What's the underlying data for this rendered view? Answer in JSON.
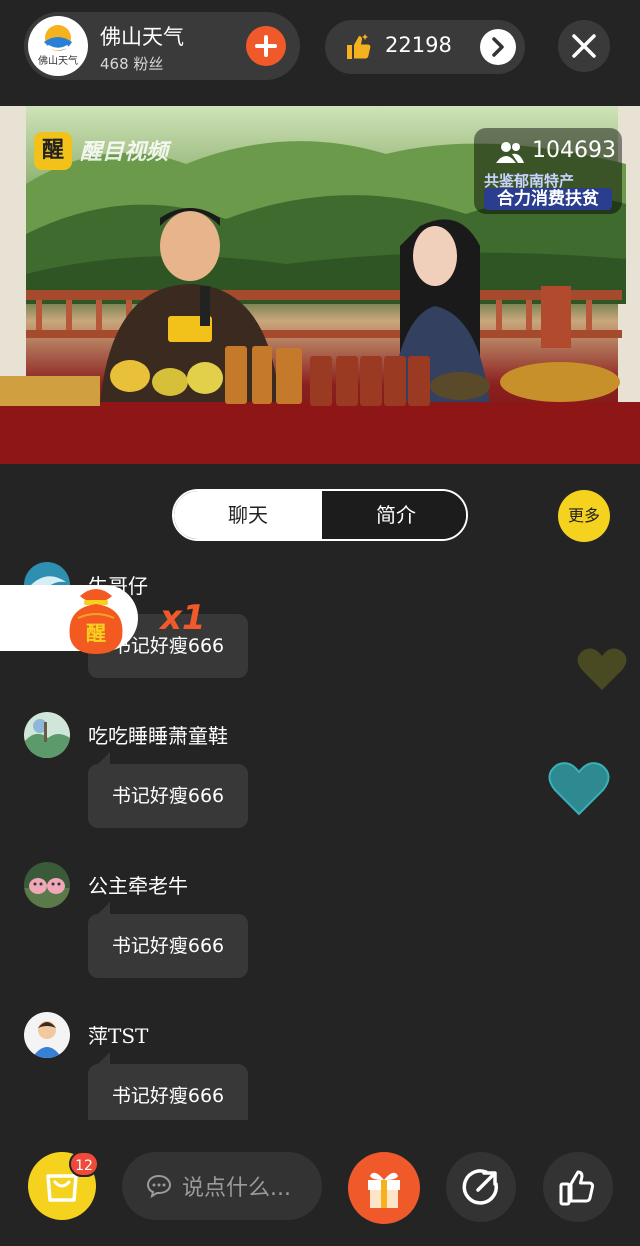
{
  "host": {
    "name": "佛山天气",
    "fans": "468 粉丝",
    "avatar_text": "佛山天气",
    "follow_icon": "plus-icon"
  },
  "likes": {
    "count": "22198",
    "icon": "thumbs-up-icon",
    "next_icon": "chevron-right-icon"
  },
  "close_icon": "close-icon",
  "video": {
    "watermark_badge": "醒",
    "watermark_text": "醒目视频",
    "viewers": "104693",
    "tag_line1": "共鉴郁南特产",
    "tag_line2": "合力消费扶贫",
    "mic_label": "醒目视频"
  },
  "tabs": {
    "chat": "聊天",
    "intro": "简介",
    "active": "chat"
  },
  "more": "更多",
  "gift_overlay": {
    "bag_text": "醒",
    "count": "x1"
  },
  "messages": [
    {
      "user": "牛哥仔",
      "text": "书记好瘦666",
      "avatar": "dolphin"
    },
    {
      "user": "吃吃睡睡萧童鞋",
      "text": "书记好瘦666",
      "avatar": "landscape"
    },
    {
      "user": "公主牵老牛",
      "text": "书记好瘦666",
      "avatar": "pigs"
    },
    {
      "user": "萍TST",
      "text": "书记好瘦666",
      "avatar": "person"
    }
  ],
  "bottom": {
    "cart_badge": "12",
    "comment_placeholder": "说点什么...",
    "icons": [
      "shopping-bag-icon",
      "chat-bubble-icon",
      "gift-icon",
      "share-icon",
      "thumbs-up-icon"
    ]
  },
  "colors": {
    "accent_orange": "#f05a2a",
    "accent_yellow": "#f5d21e",
    "background": "#242424"
  }
}
